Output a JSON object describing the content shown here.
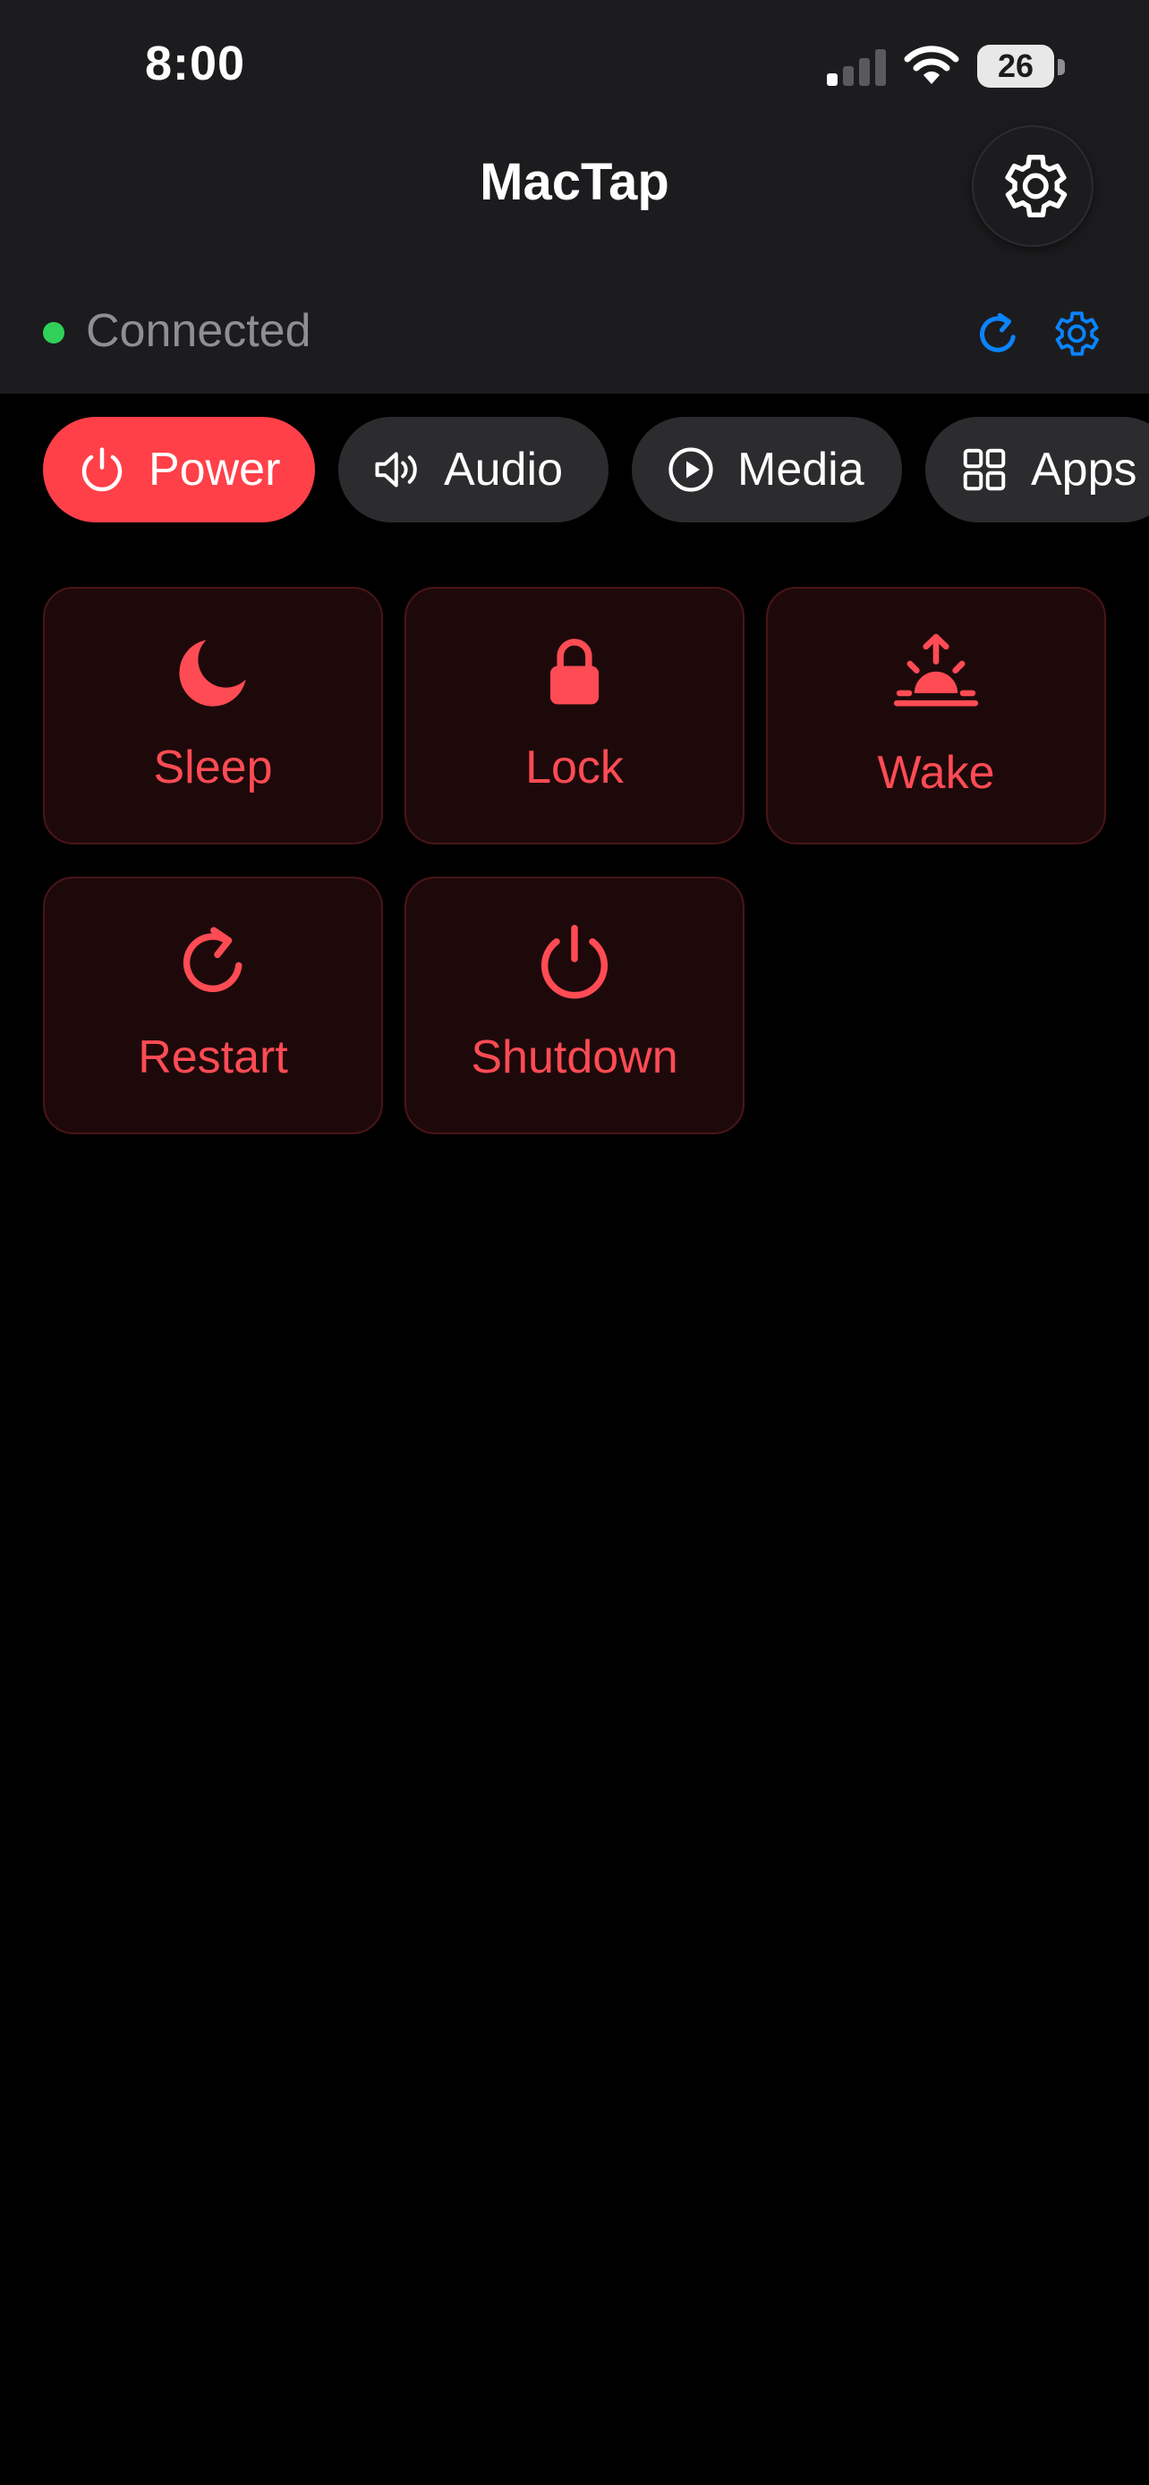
{
  "status_bar": {
    "time": "8:00",
    "battery_level": "26"
  },
  "nav": {
    "title": "MacTap",
    "settings_icon": "gear-icon"
  },
  "connection": {
    "status_label": "Connected",
    "status_color": "#30d158",
    "refresh_icon": "refresh-icon",
    "settings_icon": "gear-icon",
    "accent_color": "#0a84ff"
  },
  "tabs": [
    {
      "label": "Power",
      "icon": "power-icon",
      "active": true
    },
    {
      "label": "Audio",
      "icon": "speaker-icon",
      "active": false
    },
    {
      "label": "Media",
      "icon": "play-icon",
      "active": false
    },
    {
      "label": "Apps",
      "icon": "grid-icon",
      "active": false
    }
  ],
  "actions": [
    {
      "label": "Sleep",
      "icon": "moon-icon"
    },
    {
      "label": "Lock",
      "icon": "lock-icon"
    },
    {
      "label": "Wake",
      "icon": "sunrise-icon"
    },
    {
      "label": "Restart",
      "icon": "restart-icon"
    },
    {
      "label": "Shutdown",
      "icon": "power-icon"
    }
  ],
  "colors": {
    "background": "#000000",
    "header_background": "#1c1c1e",
    "accent_red": "#ff4049",
    "tile_background": "#1e090a",
    "tile_border": "#4a1518",
    "tile_text": "#ff4b54",
    "inactive_tab": "#2c2c2e"
  }
}
